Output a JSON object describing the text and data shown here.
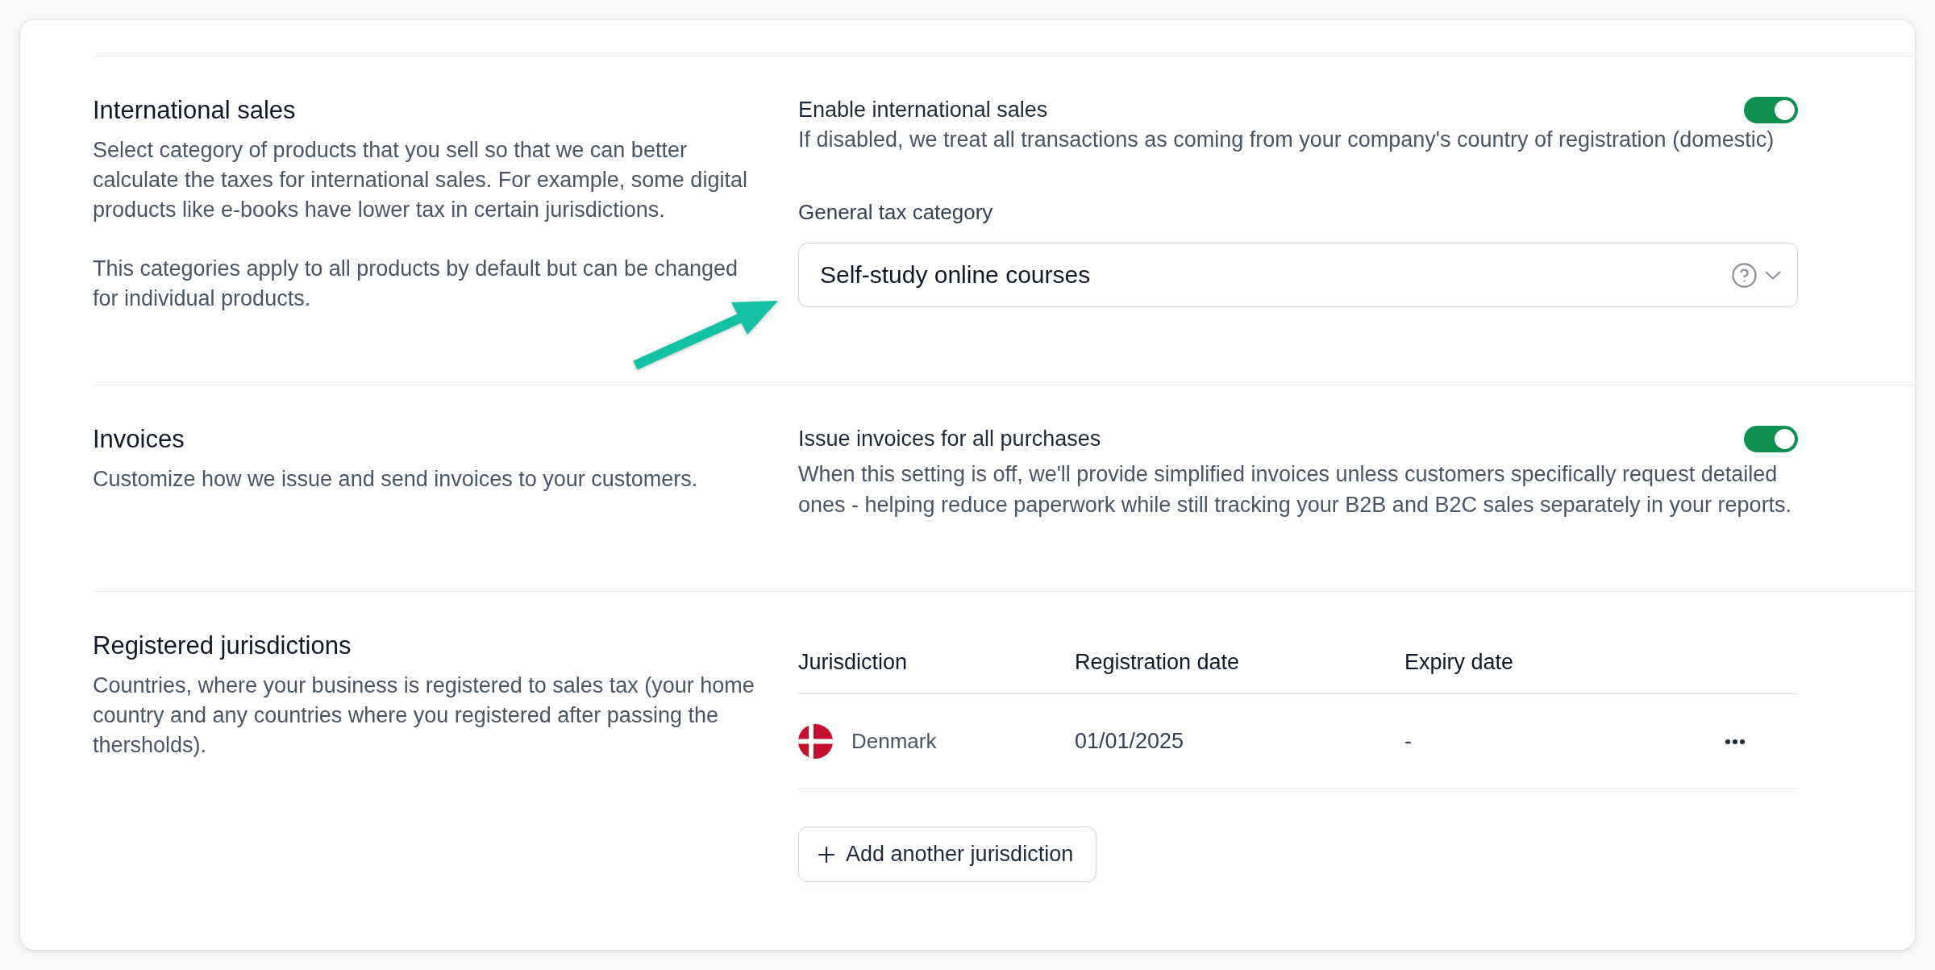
{
  "sections": [
    {
      "kind": "settings",
      "title": "International sales",
      "description": [
        "Select category of products that you sell so that we can better calculate the taxes for international sales. For example, some digital products like e-books have lower tax in certain jurisdictions.",
        "This categories apply to all products by default but can be changed for individual products."
      ],
      "setting": {
        "label": "Enable international sales",
        "on": true,
        "hint": "If disabled, we treat all transactions as coming from your company's country of registration (domestic)"
      },
      "select": {
        "label": "General tax category",
        "value": "Self-study online courses"
      }
    },
    {
      "kind": "settings",
      "title": "Invoices",
      "description": [
        "Customize how we issue and send invoices to your customers."
      ],
      "setting": {
        "label": "Issue invoices for all purchases",
        "on": true,
        "hint": "When this setting is off, we'll provide simplified invoices unless customers specifically request detailed ones - helping reduce paperwork while still tracking your B2B and B2C sales separately in your reports."
      }
    },
    {
      "kind": "table",
      "title": "Registered jurisdictions",
      "description": [
        "Countries, where your business is registered to sales tax (your home country and any countries where you registered after passing the thersholds)."
      ],
      "table": {
        "columns": [
          "Jurisdiction",
          "Registration date",
          "Expiry date"
        ],
        "rows": [
          {
            "jurisdiction": "Denmark",
            "registration_date": "01/01/2025",
            "expiry_date": "-"
          }
        ]
      },
      "add_button": "Add another jurisdiction"
    }
  ]
}
